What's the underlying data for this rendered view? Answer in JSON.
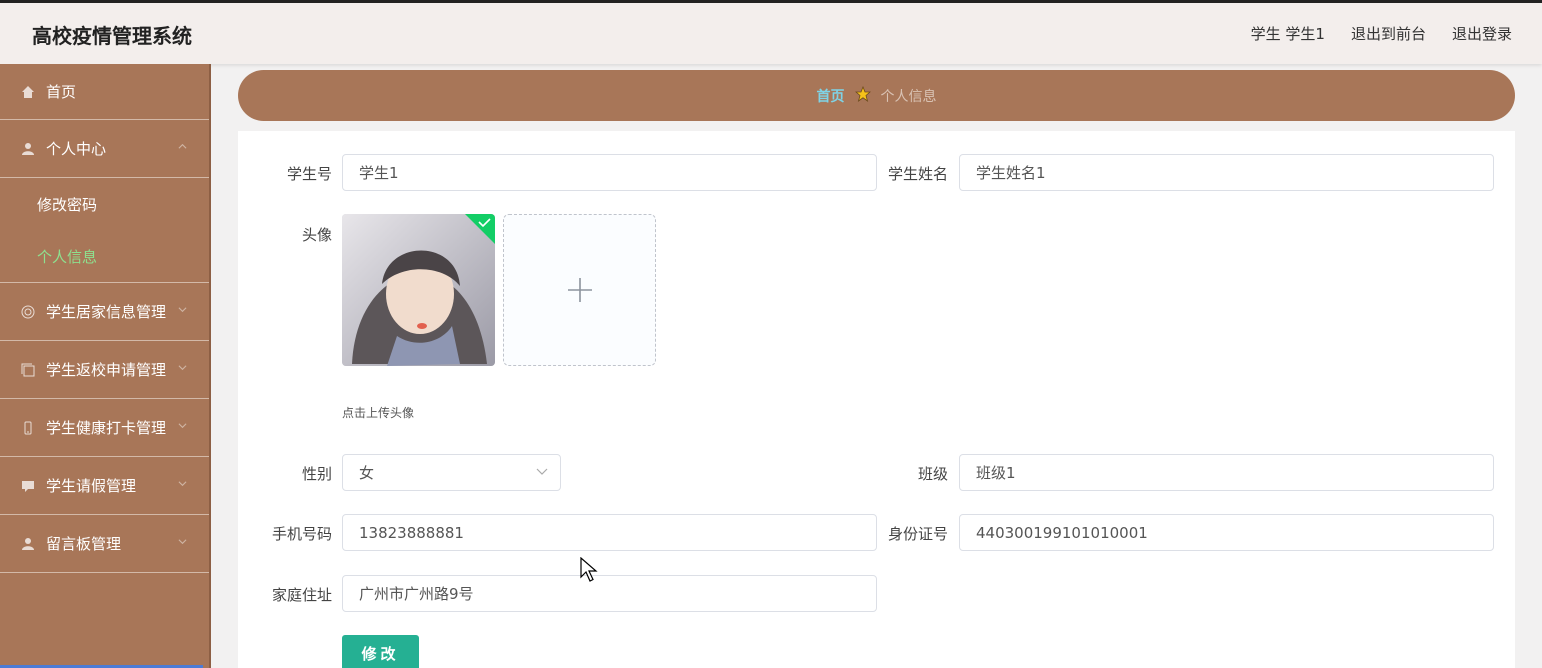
{
  "header": {
    "title": "高校疫情管理系统",
    "user_label": "学生 学生1",
    "to_frontend": "退出到前台",
    "logout": "退出登录"
  },
  "sidebar": {
    "items": [
      {
        "label": "首页",
        "icon": "home-icon"
      },
      {
        "label": "个人中心",
        "icon": "user-icon",
        "expanded": true,
        "children": [
          {
            "label": "修改密码"
          },
          {
            "label": "个人信息",
            "active": true
          }
        ]
      },
      {
        "label": "学生居家信息管理",
        "icon": "target-icon"
      },
      {
        "label": "学生返校申请管理",
        "icon": "copy-icon"
      },
      {
        "label": "学生健康打卡管理",
        "icon": "phone-icon"
      },
      {
        "label": "学生请假管理",
        "icon": "message-icon"
      },
      {
        "label": "留言板管理",
        "icon": "user-icon"
      }
    ]
  },
  "breadcrumb": {
    "home": "首页",
    "current": "个人信息"
  },
  "form": {
    "student_no_label": "学生号",
    "student_no": "学生1",
    "student_name_label": "学生姓名",
    "student_name": "学生姓名1",
    "avatar_label": "头像",
    "upload_hint": "点击上传头像",
    "gender_label": "性别",
    "gender": "女",
    "class_label": "班级",
    "class": "班级1",
    "phone_label": "手机号码",
    "phone": "13823888881",
    "id_card_label": "身份证号",
    "id_card": "440300199101010001",
    "address_label": "家庭住址",
    "address": "广州市广州路9号",
    "submit_label": "修改"
  },
  "colors": {
    "brand": "#a87658",
    "active_sub": "#8ee08e",
    "breadcrumb_home": "#7fd3e6",
    "submit": "#25b093"
  }
}
